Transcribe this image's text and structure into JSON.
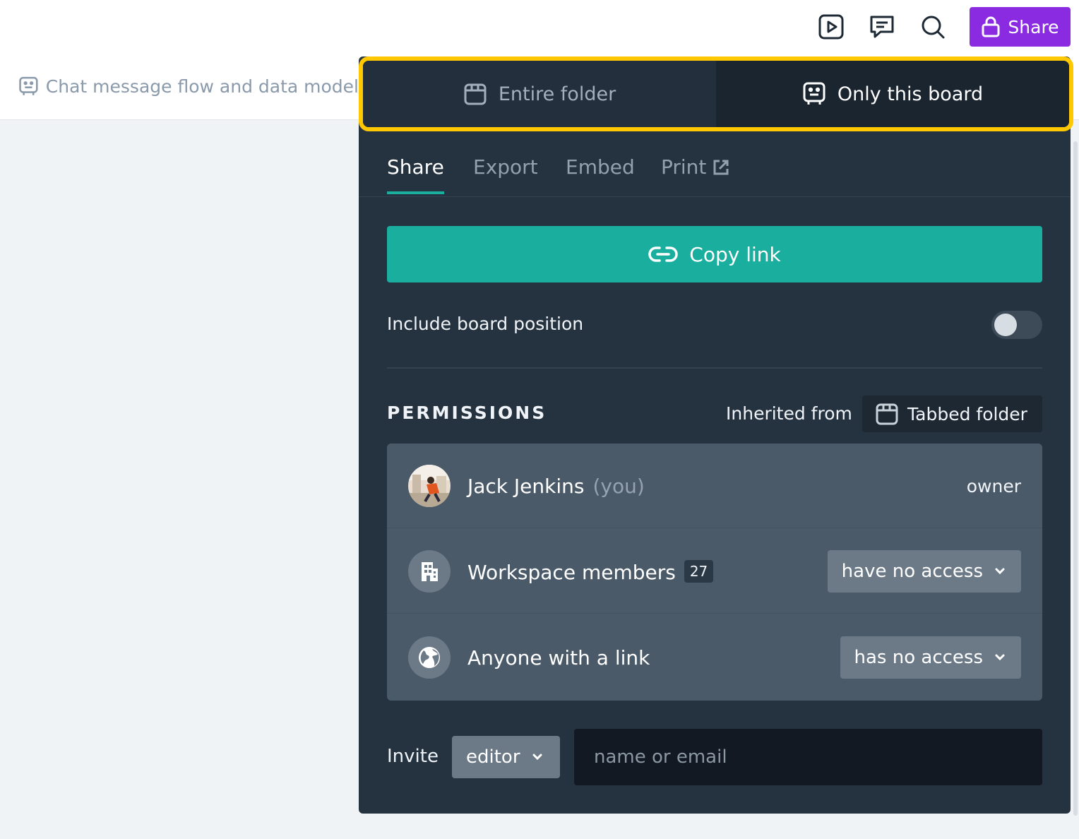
{
  "header": {
    "board_title": "Chat message flow and data model",
    "share_label": "Share",
    "icons": [
      "presentation-icon",
      "comment-icon",
      "search-icon"
    ]
  },
  "share_panel": {
    "scope": {
      "options": [
        "Entire folder",
        "Only this board"
      ],
      "selected": "Only this board"
    },
    "tabs": [
      "Share",
      "Export",
      "Embed",
      "Print"
    ],
    "active_tab": "Share",
    "copy_link_label": "Copy link",
    "include_position": {
      "label": "Include board position",
      "enabled": false
    },
    "permissions": {
      "title": "PERMISSIONS",
      "inherited_label": "Inherited from",
      "inherited_source": "Tabbed folder",
      "rows": [
        {
          "name": "Jack Jenkins",
          "suffix": "(you)",
          "role": "owner"
        },
        {
          "name": "Workspace members",
          "count": "27",
          "access": "have no access"
        },
        {
          "name": "Anyone with a link",
          "access": "has no access"
        }
      ]
    },
    "invite": {
      "label": "Invite",
      "role": "editor",
      "placeholder": "name or email"
    }
  },
  "colors": {
    "brand": "#8a2be2",
    "accent": "#1aae9f",
    "highlight": "#ffc800",
    "panel": "#253340"
  }
}
